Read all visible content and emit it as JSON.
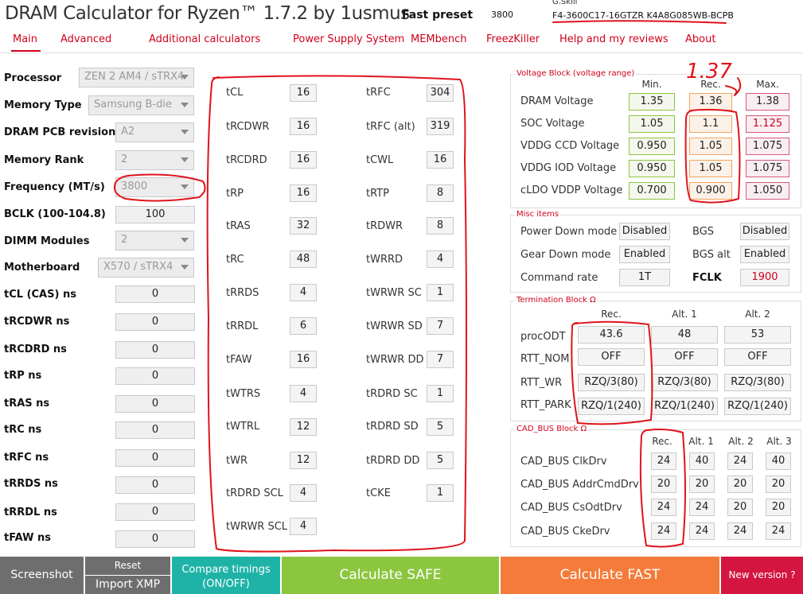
{
  "header": {
    "title": "DRAM Calculator for Ryzen™ 1.7.2 by 1usmus",
    "preset_label": "Fast preset",
    "preset_value": "3800",
    "brand": "G.Skill",
    "part_number": "F4-3600C17-16GTZR K4A8G085WB-BCPB"
  },
  "menu": [
    "Main",
    "Advanced",
    "Additional calculators",
    "Power Supply System",
    "MEMbench",
    "FreezKiller",
    "Help and my reviews",
    "About"
  ],
  "left": {
    "processor": {
      "label": "Processor",
      "value": "ZEN 2 AM4 / sTRX4"
    },
    "memory_type": {
      "label": "Memory Type",
      "value": "Samsung B-die"
    },
    "pcb": {
      "label": "DRAM PCB revision",
      "value": "A2"
    },
    "rank": {
      "label": "Memory Rank",
      "value": "2"
    },
    "frequency": {
      "label": "Frequency (MT/s)",
      "value": "3800"
    },
    "bclk": {
      "label": "BCLK (100-104.8)",
      "value": "100"
    },
    "dimm": {
      "label": "DIMM Modules",
      "value": "2"
    },
    "motherboard": {
      "label": "Motherboard",
      "value": "X570 / sTRX4"
    },
    "ns": [
      {
        "label": "tCL (CAS) ns",
        "value": "0"
      },
      {
        "label": "tRCDWR ns",
        "value": "0"
      },
      {
        "label": "tRCDRD ns",
        "value": "0"
      },
      {
        "label": "tRP ns",
        "value": "0"
      },
      {
        "label": "tRAS ns",
        "value": "0"
      },
      {
        "label": "tRC ns",
        "value": "0"
      },
      {
        "label": "tRFC ns",
        "value": "0"
      },
      {
        "label": "tRRDS ns",
        "value": "0"
      },
      {
        "label": "tRRDL ns",
        "value": "0"
      },
      {
        "label": "tFAW ns",
        "value": "0"
      }
    ]
  },
  "timings_col1": [
    {
      "label": "tCL",
      "value": "16"
    },
    {
      "label": "tRCDWR",
      "value": "16"
    },
    {
      "label": "tRCDRD",
      "value": "16"
    },
    {
      "label": "tRP",
      "value": "16"
    },
    {
      "label": "tRAS",
      "value": "32"
    },
    {
      "label": "tRC",
      "value": "48"
    },
    {
      "label": "tRRDS",
      "value": "4"
    },
    {
      "label": "tRRDL",
      "value": "6"
    },
    {
      "label": "tFAW",
      "value": "16"
    },
    {
      "label": "tWTRS",
      "value": "4"
    },
    {
      "label": "tWTRL",
      "value": "12"
    },
    {
      "label": "tWR",
      "value": "12"
    },
    {
      "label": "tRDRD SCL",
      "value": "4"
    },
    {
      "label": "tWRWR SCL",
      "value": "4"
    }
  ],
  "timings_col2": [
    {
      "label": "tRFC",
      "value": "304"
    },
    {
      "label": "tRFC (alt)",
      "value": "319"
    },
    {
      "label": "tCWL",
      "value": "16"
    },
    {
      "label": "tRTP",
      "value": "8"
    },
    {
      "label": "tRDWR",
      "value": "8"
    },
    {
      "label": "tWRRD",
      "value": "4"
    },
    {
      "label": "tWRWR SC",
      "value": "1"
    },
    {
      "label": "tWRWR SD",
      "value": "7"
    },
    {
      "label": "tWRWR DD",
      "value": "7"
    },
    {
      "label": "tRDRD SC",
      "value": "1"
    },
    {
      "label": "tRDRD SD",
      "value": "5"
    },
    {
      "label": "tRDRD DD",
      "value": "5"
    },
    {
      "label": "tCKE",
      "value": "1"
    }
  ],
  "voltage": {
    "title": "Voltage Block (voltage range)",
    "cols": [
      "Min.",
      "Rec.",
      "Max."
    ],
    "rows": [
      {
        "label": "DRAM Voltage",
        "min": "1.35",
        "rec": "1.36",
        "max": "1.38"
      },
      {
        "label": "SOC Voltage",
        "min": "1.05",
        "rec": "1.1",
        "max": "1.125"
      },
      {
        "label": "VDDG  CCD Voltage",
        "min": "0.950",
        "rec": "1.05",
        "max": "1.075"
      },
      {
        "label": "VDDG  IOD Voltage",
        "min": "0.950",
        "rec": "1.05",
        "max": "1.075"
      },
      {
        "label": "cLDO VDDP Voltage",
        "min": "0.700",
        "rec": "0.900",
        "max": "1.050"
      }
    ]
  },
  "misc": {
    "title": "Misc items",
    "power_down": {
      "label": "Power Down mode",
      "value": "Disabled"
    },
    "gear_down": {
      "label": "Gear Down mode",
      "value": "Enabled"
    },
    "command_rate": {
      "label": "Command rate",
      "value": "1T"
    },
    "bgs": {
      "label": "BGS",
      "value": "Disabled"
    },
    "bgs_alt": {
      "label": "BGS alt",
      "value": "Enabled"
    },
    "fclk": {
      "label": "FCLK",
      "value": "1900"
    }
  },
  "termination": {
    "title": "Termination Block Ω",
    "cols": [
      "Rec.",
      "Alt. 1",
      "Alt. 2"
    ],
    "rows": [
      {
        "label": "procODT",
        "values": [
          "43.6",
          "48",
          "53"
        ]
      },
      {
        "label": "RTT_NOM",
        "values": [
          "OFF",
          "OFF",
          "OFF"
        ]
      },
      {
        "label": "RTT_WR",
        "values": [
          "RZQ/3(80)",
          "RZQ/3(80)",
          "RZQ/3(80)"
        ]
      },
      {
        "label": "RTT_PARK",
        "values": [
          "RZQ/1(240)",
          "RZQ/1(240)",
          "RZQ/1(240)"
        ]
      }
    ]
  },
  "cadbus": {
    "title": "CAD_BUS Block Ω",
    "cols": [
      "Rec.",
      "Alt. 1",
      "Alt. 2",
      "Alt. 3"
    ],
    "rows": [
      {
        "label": "CAD_BUS ClkDrv",
        "values": [
          "24",
          "40",
          "24",
          "40"
        ]
      },
      {
        "label": "CAD_BUS AddrCmdDrv",
        "values": [
          "20",
          "20",
          "20",
          "20"
        ]
      },
      {
        "label": "CAD_BUS CsOdtDrv",
        "values": [
          "24",
          "24",
          "20",
          "20"
        ]
      },
      {
        "label": "CAD_BUS CkeDrv",
        "values": [
          "24",
          "24",
          "24",
          "24"
        ]
      }
    ]
  },
  "annotation": {
    "handwritten": "1.37"
  },
  "footer": {
    "screenshot": "Screenshot",
    "reset": "Reset",
    "import_xmp": "Import XMP",
    "compare": "Compare timings (ON/OFF)",
    "calc_safe": "Calculate SAFE",
    "calc_fast": "Calculate FAST",
    "new_version": "New version ?"
  },
  "colors": {
    "accent_red": "#d0021b",
    "safe_green": "#8cc63f",
    "fast_orange": "#f47b3a",
    "compare_teal": "#1fb3a8",
    "dark_gray": "#6e6e6e",
    "new_version_red": "#d4153f"
  }
}
